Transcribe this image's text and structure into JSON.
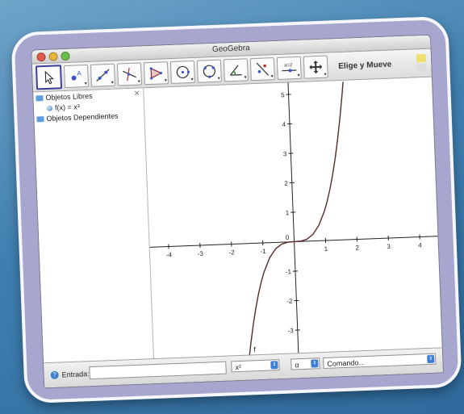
{
  "window": {
    "title": "GeoGebra"
  },
  "toolbar": {
    "mode_label": "Elige y Mueve",
    "tools": [
      {
        "name": "move-tool",
        "icon": "cursor-arrow-icon"
      },
      {
        "name": "point-tool",
        "icon": "point-icon"
      },
      {
        "name": "line-tool",
        "icon": "line-icon"
      },
      {
        "name": "perpendicular-tool",
        "icon": "perpendicular-icon"
      },
      {
        "name": "polygon-tool",
        "icon": "polygon-icon"
      },
      {
        "name": "circle-tool",
        "icon": "circle-icon"
      },
      {
        "name": "conic-tool",
        "icon": "conic-icon"
      },
      {
        "name": "angle-tool",
        "icon": "angle-icon"
      },
      {
        "name": "reflect-tool",
        "icon": "reflect-icon"
      },
      {
        "name": "slider-tool",
        "icon": "slider-icon",
        "label": "a=2"
      },
      {
        "name": "move-view-tool",
        "icon": "move-view-icon"
      }
    ]
  },
  "algebra": {
    "free_objects": "Objetos Libres",
    "function_label": "f(x) = x³",
    "dependent_objects": "Objetos Dependientes"
  },
  "graph": {
    "x_ticks": [
      "-4",
      "-3",
      "-2",
      "-1",
      "1",
      "2",
      "3",
      "4"
    ],
    "y_ticks": [
      "5",
      "4",
      "3",
      "2",
      "1",
      "-1",
      "-2",
      "-3"
    ],
    "origin_label": "0",
    "curve_label": "f"
  },
  "inputbar": {
    "label": "Entrada:",
    "combo1_value": "x²",
    "combo2_value": "α",
    "combo3_value": "Comando..."
  },
  "chart_data": {
    "type": "line",
    "title": "",
    "xlabel": "",
    "ylabel": "",
    "xlim": [
      -4.6,
      4.6
    ],
    "ylim": [
      -3.8,
      5.4
    ],
    "series": [
      {
        "name": "f",
        "x": [
          -1.6,
          -1.5,
          -1.4,
          -1.3,
          -1.2,
          -1.1,
          -1.0,
          -0.8,
          -0.6,
          -0.4,
          -0.2,
          0,
          0.2,
          0.4,
          0.6,
          0.8,
          1.0,
          1.1,
          1.2,
          1.3,
          1.4,
          1.5,
          1.6,
          1.7,
          1.75
        ],
        "y": [
          -4.096,
          -3.375,
          -2.744,
          -2.197,
          -1.728,
          -1.331,
          -1.0,
          -0.512,
          -0.216,
          -0.064,
          -0.008,
          0,
          0.008,
          0.064,
          0.216,
          0.512,
          1.0,
          1.331,
          1.728,
          2.197,
          2.744,
          3.375,
          4.096,
          4.913,
          5.359
        ]
      }
    ],
    "grid": false
  }
}
